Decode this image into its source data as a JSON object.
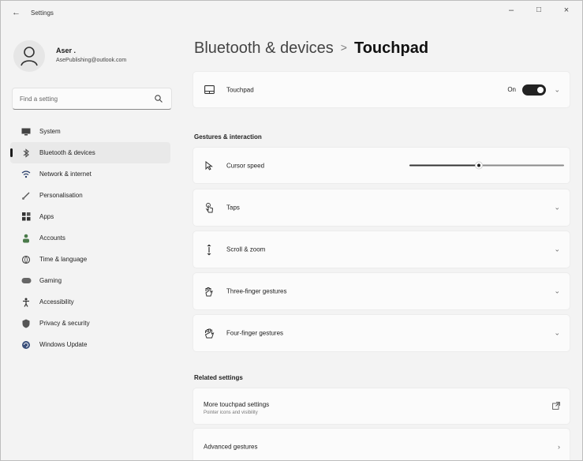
{
  "window": {
    "title": "Settings"
  },
  "profile": {
    "name": "Aser .",
    "email": "AsePublishing@outlook.com"
  },
  "search": {
    "placeholder": "Find a setting"
  },
  "nav": [
    {
      "label": "System",
      "icon": "system-icon"
    },
    {
      "label": "Bluetooth & devices",
      "icon": "bluetooth-icon",
      "active": true
    },
    {
      "label": "Network & internet",
      "icon": "wifi-icon"
    },
    {
      "label": "Personalisation",
      "icon": "brush-icon"
    },
    {
      "label": "Apps",
      "icon": "apps-icon"
    },
    {
      "label": "Accounts",
      "icon": "person-icon"
    },
    {
      "label": "Time & language",
      "icon": "globe-icon"
    },
    {
      "label": "Gaming",
      "icon": "gamepad-icon"
    },
    {
      "label": "Accessibility",
      "icon": "accessibility-icon"
    },
    {
      "label": "Privacy & security",
      "icon": "shield-icon"
    },
    {
      "label": "Windows Update",
      "icon": "update-icon"
    }
  ],
  "breadcrumb": {
    "parent": "Bluetooth & devices",
    "separator": ">",
    "current": "Touchpad"
  },
  "touchpad": {
    "label": "Touchpad",
    "state": "On",
    "enabled": true
  },
  "gestures_section": "Gestures & interaction",
  "cursor_speed": {
    "label": "Cursor speed",
    "value": 0.45
  },
  "rows": [
    {
      "label": "Taps",
      "icon": "tap-icon"
    },
    {
      "label": "Scroll & zoom",
      "icon": "scroll-icon"
    },
    {
      "label": "Three-finger gestures",
      "icon": "three-finger-icon"
    },
    {
      "label": "Four-finger gestures",
      "icon": "four-finger-icon"
    }
  ],
  "related_section": "Related settings",
  "related": [
    {
      "label": "More touchpad settings",
      "sub": "Pointer icons and visibility",
      "icon": "external-link-icon"
    },
    {
      "label": "Advanced gestures",
      "icon": "chevron-right-icon"
    }
  ],
  "colors": {
    "accent": "#1a1a1a",
    "background": "#f3f3f3",
    "card": "#fbfbfb"
  }
}
